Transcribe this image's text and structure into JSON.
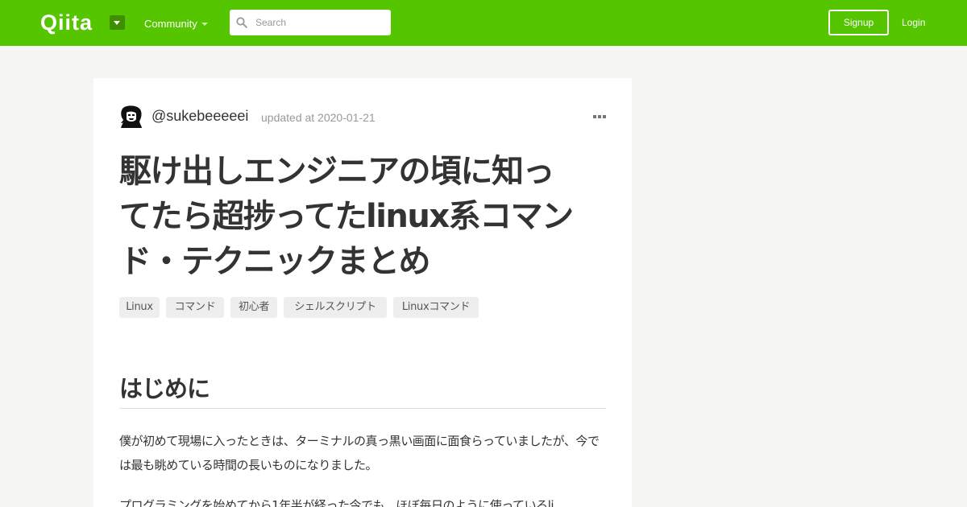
{
  "header": {
    "logo_text": "Qiita",
    "community_label": "Community",
    "search_placeholder": "Search",
    "signup_label": "Signup",
    "login_label": "Login",
    "brand_color": "#55c500"
  },
  "article": {
    "username": "@sukebeeeeei",
    "updated": "updated at 2020-01-21",
    "title_lines": [
      "駆け出しエンジニアの頃に知っ",
      "てたら超捗ってたlinux系コマン",
      "ド・テクニックまとめ"
    ],
    "tags": [
      "Linux",
      "コマンド",
      "初心者",
      "シェルスクリプト",
      "Linuxコマンド"
    ],
    "heading": "はじめに",
    "paragraphs": [
      "僕が初めて現場に入ったときは、ターミナルの真っ黒い画面に面食らっていましたが、今では最も眺めている時間の長いものになりました。",
      "プログラミングを始めてから1年半が経った今でも、ほぼ毎日のように使っているli"
    ]
  },
  "icons": {
    "search": "search-icon",
    "more": "more-icon",
    "dropdown": "chevron-down-icon"
  }
}
